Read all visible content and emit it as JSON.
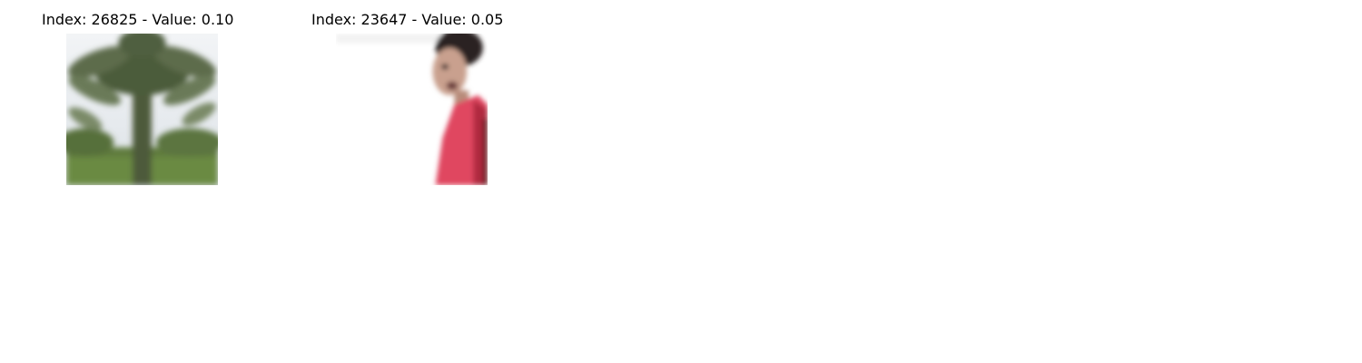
{
  "panels": [
    {
      "index": "26825",
      "value": "0.10",
      "title": "Index: 26825 - Value: 0.10",
      "subject": "palm-tree"
    },
    {
      "index": "23647",
      "value": "0.05",
      "title": "Index: 23647 - Value: 0.05",
      "subject": "person-in-red-shirt"
    }
  ]
}
